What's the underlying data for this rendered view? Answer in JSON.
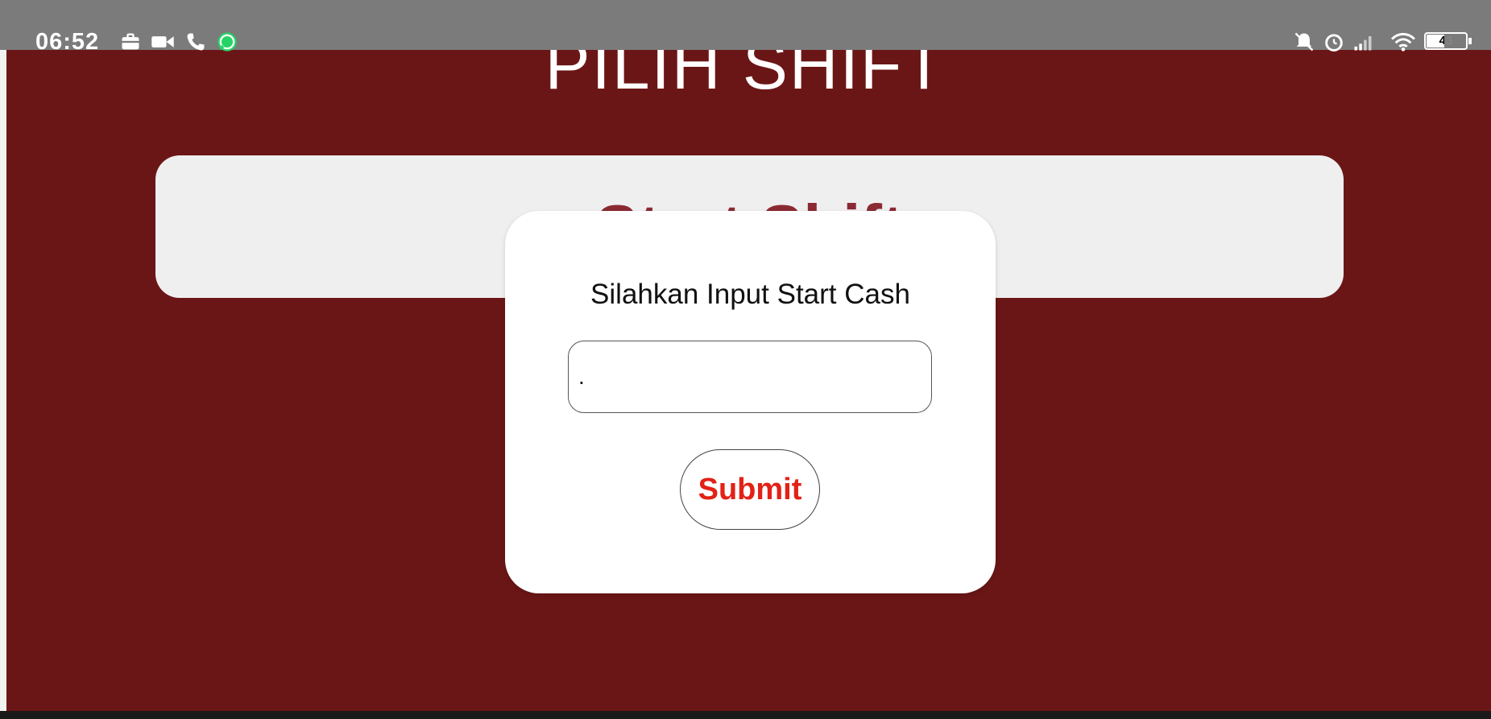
{
  "status_bar": {
    "time": "06:52",
    "left_icons": [
      "briefcase-icon",
      "video-camera-icon",
      "phone-icon",
      "whatsapp-icon"
    ],
    "right_icons": [
      "mute-icon",
      "alarm-icon",
      "signal-icon",
      "wifi-icon",
      "battery-icon"
    ],
    "battery_level": "43"
  },
  "page": {
    "title": "PILIH SHIFT",
    "background_color": "#6b1616"
  },
  "start_shift_card": {
    "label": "Start Shift"
  },
  "modal": {
    "title": "Silahkan Input Start Cash",
    "input_value": ".",
    "submit_label": "Submit",
    "submit_color": "#e32116"
  }
}
